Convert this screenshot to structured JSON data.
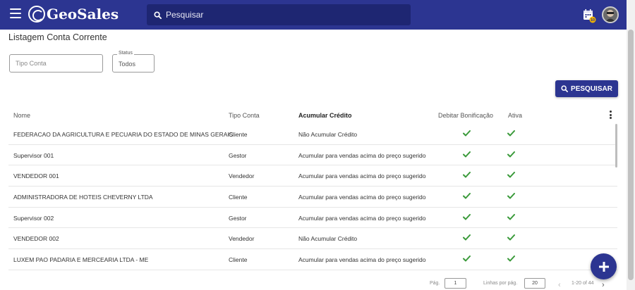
{
  "header": {
    "app_name": "GeoSales",
    "search_placeholder": "Pesquisar",
    "calendar_badge": "10"
  },
  "page": {
    "title": "Listagem Conta Corrente"
  },
  "filters": {
    "tipo_conta_placeholder": "Tipo Conta",
    "status_label": "Status",
    "status_value": "Todos",
    "search_button": "PESQUISAR"
  },
  "table": {
    "columns": [
      "Nome",
      "Tipo Conta",
      "Acumular Crédito",
      "Debitar Bonificação",
      "Ativa"
    ],
    "rows": [
      {
        "nome": "FEDERACAO DA AGRICULTURA E PECUARIA DO ESTADO DE MINAS GERAIS",
        "tipo": "Cliente",
        "acumular": "Não Acumular Crédito",
        "debitar": true,
        "ativa": true
      },
      {
        "nome": "Supervisor 001",
        "tipo": "Gestor",
        "acumular": "Acumular para vendas acima do preço sugerido",
        "debitar": true,
        "ativa": true
      },
      {
        "nome": "VENDEDOR 001",
        "tipo": "Vendedor",
        "acumular": "Acumular para vendas acima do preço sugerido",
        "debitar": true,
        "ativa": true
      },
      {
        "nome": "ADMINISTRADORA DE HOTEIS CHEVERNY LTDA",
        "tipo": "Cliente",
        "acumular": "Acumular para vendas acima do preço sugerido",
        "debitar": true,
        "ativa": true
      },
      {
        "nome": "Supervisor 002",
        "tipo": "Gestor",
        "acumular": "Acumular para vendas acima do preço sugerido",
        "debitar": true,
        "ativa": true
      },
      {
        "nome": "VENDEDOR 002",
        "tipo": "Vendedor",
        "acumular": "Não Acumular Crédito",
        "debitar": true,
        "ativa": true
      },
      {
        "nome": "LUXEM PAO PADARIA E MERCEARIA LTDA - ME",
        "tipo": "Cliente",
        "acumular": "Acumular para vendas acima do preço sugerido",
        "debitar": true,
        "ativa": true
      }
    ]
  },
  "pagination": {
    "page_label": "Pág.",
    "page_value": "1",
    "rows_label": "Linhas por pág.",
    "rows_value": "20",
    "range": "1-20 of 44"
  },
  "colors": {
    "primary": "#2c3591",
    "check": "#3a9a3a"
  }
}
